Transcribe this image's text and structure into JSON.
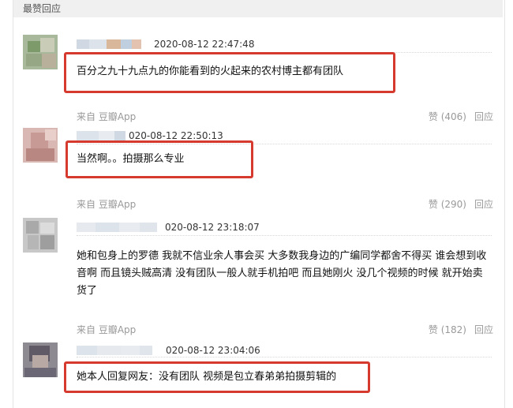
{
  "section_title": "最赞回应",
  "source_label": "来自 豆瓣App",
  "reply_label": "回应",
  "comments": [
    {
      "timestamp": "2020-08-12 22:47:48",
      "text": "百分之九十九点九的你能看到的火起来的农村博主都有团队",
      "like_label": "赞 (406)"
    },
    {
      "timestamp": "020-08-12 22:50:13",
      "text": "当然啊。。拍摄那么专业",
      "like_label": "赞 (290)"
    },
    {
      "timestamp": "020-08-12 23:18:07",
      "text_lines": [
        "她和包身上的罗德 我就不信业余人事会买 大多数我身边的广编同学都舍不得买 谁会想到收",
        "音啊 而且镜头贼高清 没有团队一般人就手机拍吧 而且她刚火 没几个视频的时候 就开始卖",
        "货了"
      ],
      "like_label": "赞 (182)"
    },
    {
      "timestamp": "020-08-12 23:04:06",
      "text": "她本人回复网友：没有团队 视频是包立春弟弟拍摄剪辑的"
    }
  ],
  "colors": {
    "highlight_border": "#d63a2f",
    "muted_text": "#999999",
    "header_bg": "#f0f0f0"
  }
}
